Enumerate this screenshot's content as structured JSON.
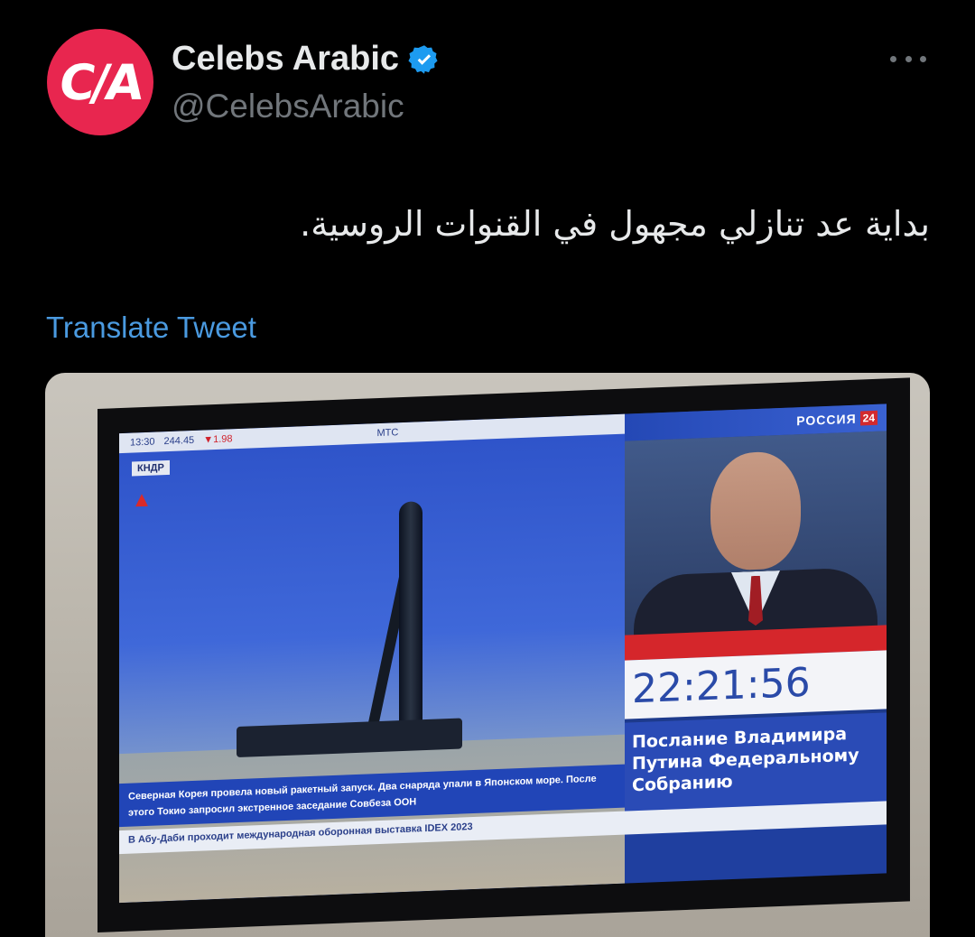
{
  "account": {
    "display_name": "Celebs Arabic",
    "handle": "@CelebsArabic",
    "avatar_text": "C/A",
    "verified": true
  },
  "tweet": {
    "text": "بداية عد تنازلي مجهول في القنوات الروسية.",
    "translate_label": "Translate Tweet"
  },
  "media": {
    "tv": {
      "channel_name": "РОССИЯ",
      "channel_number": "24",
      "top_time": "13:30",
      "top_quote": "244.45",
      "top_change": "▼1.98",
      "top_right": "МТС",
      "region_label": "КНДР",
      "ticker_text": "Северная Корея провела новый ракетный запуск. Два снаряда упали в Японском море. После этого Токио запросил экстренное заседание Совбеза ООН",
      "bottom_line": "В Абу-Даби проходит международная оборонная выставка IDEX 2023",
      "countdown": "22:21:56",
      "caption": "Послание Владимира Путина Федеральному Собранию"
    }
  },
  "colors": {
    "background": "#000000",
    "accent": "#4a9ae0",
    "verified": "#1d9bf0",
    "avatar": "#e8264f"
  }
}
